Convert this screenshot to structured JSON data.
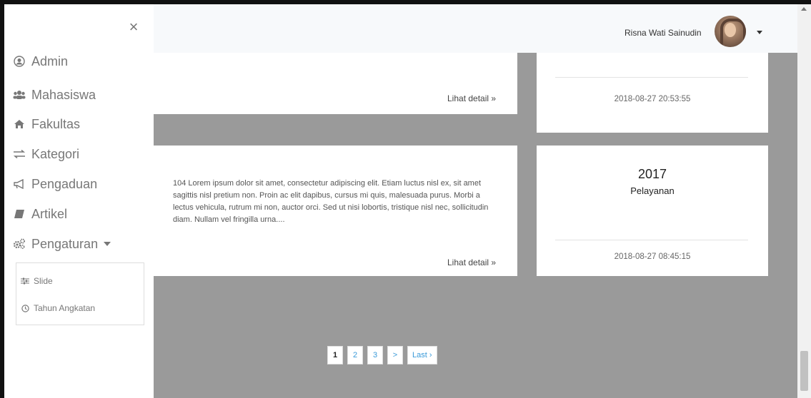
{
  "sidebar": {
    "close_icon": "×",
    "items": [
      {
        "label": "Admin",
        "icon": "user-circle-icon"
      },
      {
        "label": "Mahasiswa",
        "icon": "users-icon"
      },
      {
        "label": "Fakultas",
        "icon": "home-icon"
      },
      {
        "label": "Kategori",
        "icon": "exchange-icon"
      },
      {
        "label": "Pengaduan",
        "icon": "bullhorn-icon"
      },
      {
        "label": "Artikel",
        "icon": "book-icon"
      },
      {
        "label": "Pengaturan",
        "icon": "cogs-icon"
      }
    ],
    "submenu": [
      {
        "label": "Slide",
        "icon": "sliders-icon"
      },
      {
        "label": "Tahun Angkatan",
        "icon": "clock-icon"
      }
    ]
  },
  "header": {
    "user_name": "Risna Wati Sainudin"
  },
  "cards": [
    {
      "link_label": "Lihat detail »",
      "date": "2018-08-27 20:53:55"
    },
    {
      "text": "104 Lorem ipsum dolor sit amet, consectetur adipiscing elit. Etiam luctus nisl ex, sit amet sagittis nisl pretium non. Proin ac elit dapibus, cursus mi quis, malesuada purus. Morbi a lectus vehicula, rutrum mi non, auctor orci. Sed ut nisi lobortis, tristique nisl nec, sollicitudin diam. Nullam vel fringilla urna....",
      "link_label": "Lihat detail »",
      "year": "2017",
      "category": "Pelayanan",
      "date": "2018-08-27 08:45:15"
    }
  ],
  "pagination": {
    "pages": [
      "1",
      "2",
      "3"
    ],
    "next": ">",
    "last": "Last ›"
  },
  "colors": {
    "content_bg": "#9a9a9a",
    "header_bg": "#f7f9fb",
    "link_blue": "#3a9ad9"
  }
}
